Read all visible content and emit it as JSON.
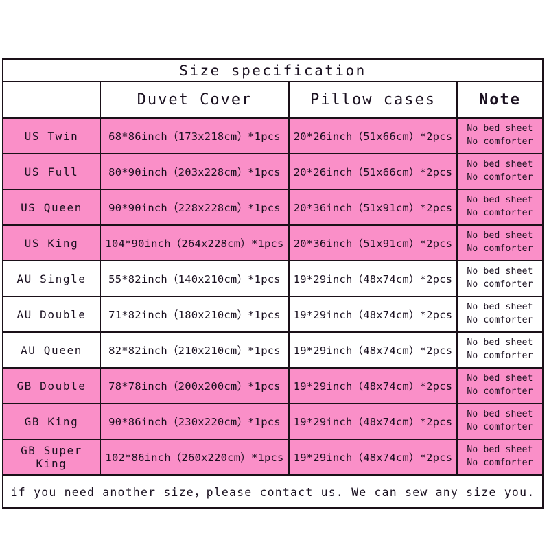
{
  "table": {
    "title": "Size specification",
    "columns": {
      "label": "",
      "duvet": "Duvet Cover",
      "pillow": "Pillow cases",
      "note": "Note"
    },
    "note_default": {
      "line1": "No bed sheet",
      "line2": "No comforter"
    },
    "rows": [
      {
        "label": "US Twin",
        "duvet": "68*86inch（173x218cm）*1pcs",
        "pillow": "20*26inch（51x66cm）*2pcs",
        "note_line1": "No bed sheet",
        "note_line2": "No comforter",
        "highlight": true
      },
      {
        "label": "US Full",
        "duvet": "80*90inch（203x228cm）*1pcs",
        "pillow": "20*26inch（51x66cm）*2pcs",
        "note_line1": "No bed sheet",
        "note_line2": "No comforter",
        "highlight": true
      },
      {
        "label": "US Queen",
        "duvet": "90*90inch（228x228cm）*1pcs",
        "pillow": "20*36inch（51x91cm）*2pcs",
        "note_line1": "No bed sheet",
        "note_line2": "No comforter",
        "highlight": true
      },
      {
        "label": "US King",
        "duvet": "104*90inch（264x228cm）*1pcs",
        "pillow": "20*36inch（51x91cm）*2pcs",
        "note_line1": "No bed sheet",
        "note_line2": "No comforter",
        "highlight": true
      },
      {
        "label": "AU Single",
        "duvet": "55*82inch（140x210cm）*1pcs",
        "pillow": "19*29inch（48x74cm）*2pcs",
        "note_line1": "No bed sheet",
        "note_line2": "No comforter",
        "highlight": false
      },
      {
        "label": "AU Double",
        "duvet": "71*82inch（180x210cm）*1pcs",
        "pillow": "19*29inch（48x74cm）*2pcs",
        "note_line1": "No bed sheet",
        "note_line2": "No comforter",
        "highlight": false
      },
      {
        "label": "AU Queen",
        "duvet": "82*82inch（210x210cm）*1pcs",
        "pillow": "19*29inch（48x74cm）*2pcs",
        "note_line1": "No bed sheet",
        "note_line2": "No comforter",
        "highlight": false
      },
      {
        "label": "GB Double",
        "duvet": "78*78inch（200x200cm）*1pcs",
        "pillow": "19*29inch（48x74cm）*2pcs",
        "note_line1": "No bed sheet",
        "note_line2": "No comforter",
        "highlight": true
      },
      {
        "label": "GB King",
        "duvet": "90*86inch（230x220cm）*1pcs",
        "pillow": "19*29inch（48x74cm）*2pcs",
        "note_line1": "No bed sheet",
        "note_line2": "No comforter",
        "highlight": true
      },
      {
        "label": "GB Super King",
        "duvet": "102*86inch（260x220cm）*1pcs",
        "pillow": "19*29inch（48x74cm）*2pcs",
        "note_line1": "No bed sheet",
        "note_line2": "No comforter",
        "highlight": true
      }
    ],
    "footer": "if you need another size，please contact us. We can sew any size you.",
    "colors": {
      "highlight_row": "#fa8fc8",
      "plain_row": "#ffffff",
      "border": "#1a1018",
      "text": "#1a1020",
      "page_background": "#ffffff"
    }
  }
}
